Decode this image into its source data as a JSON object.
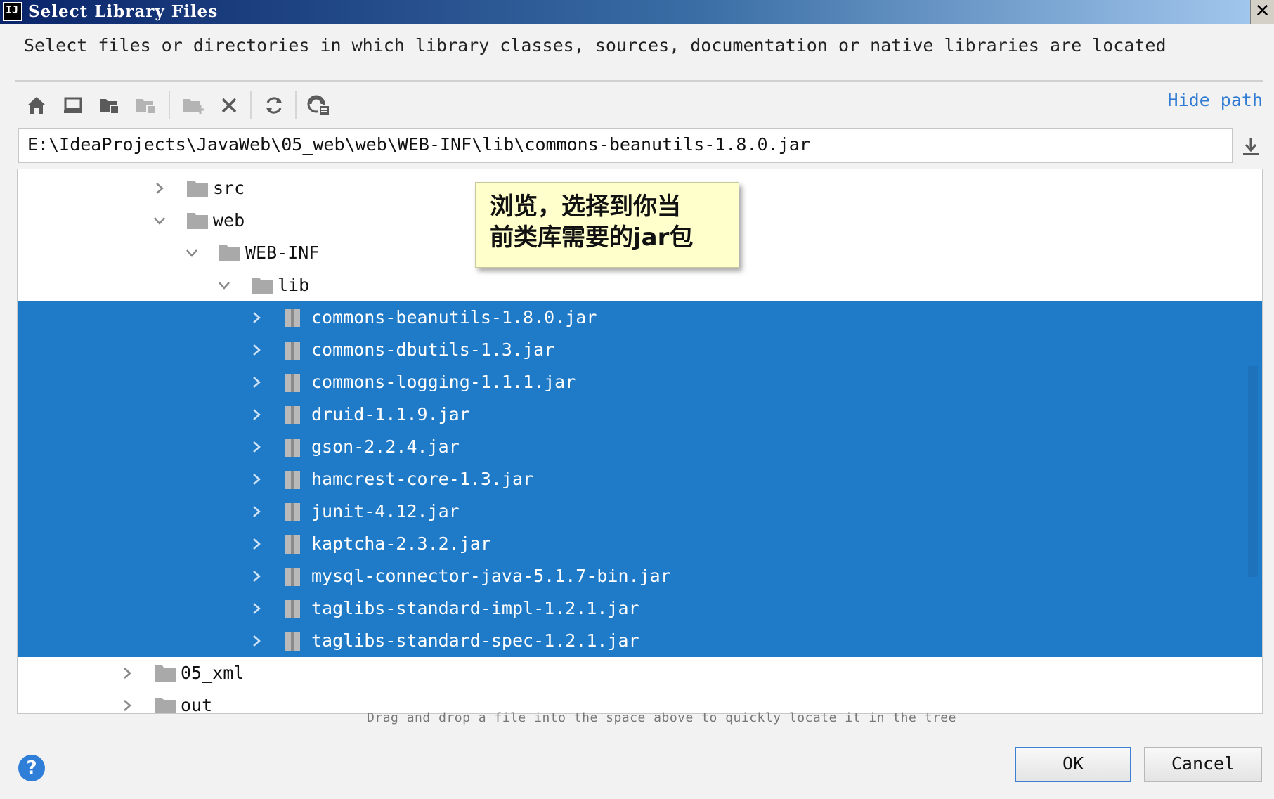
{
  "window": {
    "app_icon_text": "IJ",
    "title": "Select Library Files",
    "close_glyph": "✕"
  },
  "description": "Select files or directories in which library classes, sources, documentation or native libraries are located",
  "toolbar": {
    "icons": [
      "home-icon",
      "desktop-icon",
      "project-folder-icon",
      "module-folder-icon",
      "new-folder-icon",
      "delete-icon",
      "refresh-icon",
      "show-hidden-icon"
    ],
    "hide_path_label": "Hide path"
  },
  "path_field": {
    "value": "E:\\IdeaProjects\\JavaWeb\\05_web\\web\\WEB-INF\\lib\\commons-beanutils-1.8.0.jar"
  },
  "tree": {
    "src": "src",
    "web": "web",
    "webinf": "WEB-INF",
    "lib": "lib",
    "jars": [
      "commons-beanutils-1.8.0.jar",
      "commons-dbutils-1.3.jar",
      "commons-logging-1.1.1.jar",
      "druid-1.1.9.jar",
      "gson-2.2.4.jar",
      "hamcrest-core-1.3.jar",
      "junit-4.12.jar",
      "kaptcha-2.3.2.jar",
      "mysql-connector-java-5.1.7-bin.jar",
      "taglibs-standard-impl-1.2.1.jar",
      "taglibs-standard-spec-1.2.1.jar"
    ],
    "xml": "05_xml",
    "out": "out"
  },
  "tooltip": "浏览，选择到你当\n前类库需要的jar包",
  "drag_hint": "Drag and drop a file into the space above to quickly locate it in the tree",
  "buttons": {
    "help": "?",
    "ok": "OK",
    "cancel": "Cancel"
  },
  "colors": {
    "selection": "#1f7ac8",
    "link": "#2f7ad3",
    "title_bar": "#0a246a",
    "tooltip_bg": "#ffffcc"
  }
}
